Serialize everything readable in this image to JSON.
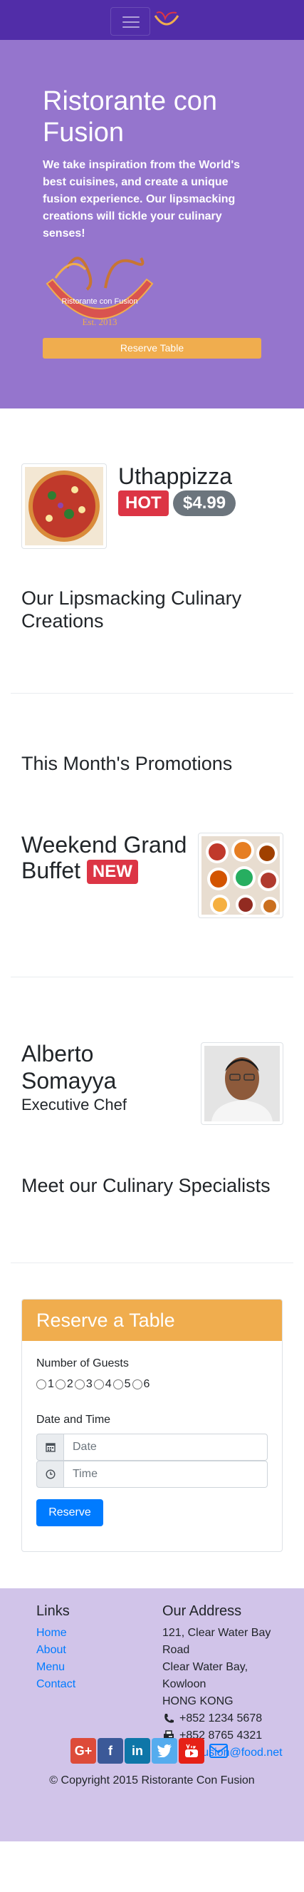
{
  "jumbotron": {
    "title": "Ristorante con Fusion",
    "text": "We take inspiration from the World's best cuisines, and create a unique fusion experience. Our lipsmacking creations will tickle your culinary senses!",
    "logo_text": "Ristorante con Fusion",
    "logo_est": "Est. 2013",
    "reserve_button": "Reserve Table"
  },
  "dish": {
    "name": "Uthappizza",
    "badge": "HOT",
    "price": "$4.99"
  },
  "sections": {
    "creations_title": "Our Lipsmacking Culinary Creations",
    "promotions_title": "This Month's Promotions",
    "specialists_title": "Meet our Culinary Specialists"
  },
  "promotion": {
    "name": "Weekend Grand Buffet",
    "badge": "NEW"
  },
  "leader": {
    "name": "Alberto Somayya",
    "role": "Executive Chef"
  },
  "reserve": {
    "header": "Reserve a Table",
    "guests_label": "Number of Guests",
    "guest_options": [
      "1",
      "2",
      "3",
      "4",
      "5",
      "6"
    ],
    "datetime_label": "Date and Time",
    "date_placeholder": "Date",
    "time_placeholder": "Time",
    "submit": "Reserve"
  },
  "footer": {
    "links_title": "Links",
    "links": [
      "Home",
      "About",
      "Menu",
      "Contact"
    ],
    "address_title": "Our Address",
    "address_lines": [
      "121, Clear Water Bay",
      "Road",
      "Clear Water Bay,",
      "Kowloon",
      "HONG KONG"
    ],
    "phone": "+852 1234 5678",
    "fax": "+852 8765 4321",
    "email": "confusion@food.net",
    "copyright": "© Copyright 2015 Ristorante Con Fusion"
  },
  "colors": {
    "navbar": "#512da8",
    "jumbotron": "#9575cd",
    "accent": "#f0ad4e",
    "footer": "#d1c4e9",
    "link": "#007bff",
    "danger": "#dc3545"
  },
  "icons": [
    "hamburger-icon",
    "calendar-icon",
    "clock-icon",
    "phone-icon",
    "fax-icon",
    "envelope-icon",
    "google-plus-icon",
    "facebook-icon",
    "linkedin-icon",
    "twitter-icon",
    "youtube-icon",
    "mail-icon"
  ]
}
